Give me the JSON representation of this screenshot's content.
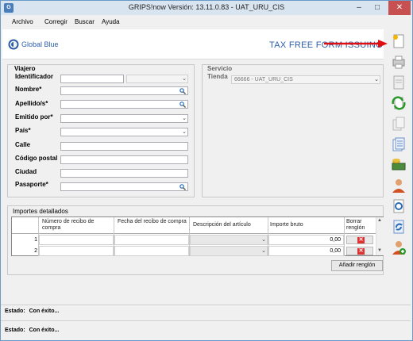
{
  "window": {
    "title": "GRIPS!now Versión: 13.11.0.83 - UAT_URU_CIS",
    "minimize": "–",
    "maximize": "□",
    "close": "✕"
  },
  "menu": {
    "items": [
      {
        "label": "Archivo"
      },
      {
        "label": "Corregir"
      },
      {
        "label": "Buscar"
      },
      {
        "label": "Ayuda"
      }
    ]
  },
  "brand": {
    "logo_text": "Global Blue",
    "title": "TAX FREE FORM ISSUING"
  },
  "viajero": {
    "title": "Viajero",
    "fields": [
      {
        "label": "Identificador"
      },
      {
        "label": "Nombre*"
      },
      {
        "label": "Apellido/s*"
      },
      {
        "label": "Emitido por*"
      },
      {
        "label": "País*"
      },
      {
        "label": "Calle"
      },
      {
        "label": "Código postal"
      },
      {
        "label": "Ciudad"
      },
      {
        "label": "Pasaporte*"
      }
    ]
  },
  "servicio": {
    "title": "Servicio",
    "tienda_label": "Tienda",
    "tienda_value": "66666 - UAT_URU_CIS"
  },
  "importes": {
    "title": "Importes detallados",
    "headers": [
      "Número de recibo de compra",
      "Fecha del recibo de compra",
      "Descripción del artículo",
      "Importe bruto",
      "Borrar renglón"
    ],
    "rows": [
      {
        "num": "1",
        "importe": "0,00"
      },
      {
        "num": "2",
        "importe": "0,00"
      }
    ],
    "add_row_label": "Añadir renglón"
  },
  "status": {
    "label": "Estado:",
    "value": "Con éxito..."
  },
  "colors": {
    "brand": "#2d5ea9",
    "delete": "#dd3333",
    "arrow": "#e01010"
  },
  "toolbar_icons": [
    "new-form-icon",
    "print-icon",
    "document-icon",
    "refresh-icon",
    "copy-icon",
    "list-icon",
    "money-icon",
    "user-icon",
    "search-document-icon",
    "sync-icon",
    "user-add-icon"
  ]
}
